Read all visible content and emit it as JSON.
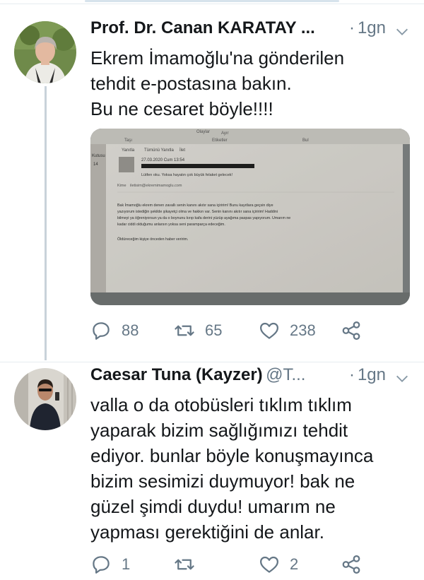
{
  "tweets": [
    {
      "author": {
        "display_name": "Prof. Dr. Canan KARATAY ...",
        "handle": "",
        "avatar_icon": "profile-photo-woman"
      },
      "separator": "·",
      "time": "1gn",
      "text_lines": [
        "Ekrem İmamoğlu'na gönderilen",
        "tehdit e-postasına bakın.",
        "Bu ne cesaret böyle!!!!"
      ],
      "media": {
        "type": "photo-of-email-screen",
        "toolbar": [
          "Yanıtla",
          "Tümünü Yanıtla",
          "İlet"
        ],
        "ribbon": [
          "Taşı",
          "Etiketler",
          "Bul",
          "Ayır",
          "Olaylar"
        ],
        "sidebar_labels": [
          "Kutusu",
          "14"
        ],
        "email_date": "27.03.2020 Cum 13:54",
        "email_subject": "Lütfen oku. Yoksa hayatın çok büyük felaket gelecek!",
        "email_to_label": "Kime",
        "email_to": "iletisim@ekremimamoglu.com",
        "body_lines": [
          "Bak İmamoğlu ekrem denen zavallı senin kanını akıtır sana içiririm! Bunu kayıtlara geçsin diye",
          "yazıyorum istediğin şekilde şikayetçi olma ve hakkın var. Senin kanını akıtır sana içiririm! Haddini",
          "bilmeyi ya öğreniyorsun ya da o boynunu kırıp kafa derini yüzüp ayağıma paspas yapıyorum. Umarım ne",
          "kadar ciddi olduğumu anlarsın yoksa seni paramparça edeceğim."
        ],
        "closing_line": "Öldüreceğim kişiye önceden haber veririm."
      },
      "actions": {
        "replies": "88",
        "retweets": "65",
        "likes": "238"
      }
    },
    {
      "author": {
        "display_name": "Caesar Tuna (Kayzer)",
        "handle": "@T...",
        "avatar_icon": "profile-photo-man"
      },
      "separator": "·",
      "time": "1gn",
      "text_lines": [
        "valla o da otobüsleri tıklım tıklım",
        "yaparak bizim sağlığımızı tehdit",
        "ediyor. bunlar böyle konuşmayınca",
        "bizim sesimizi duymuyor! bak ne",
        "güzel şimdi duydu! umarım ne",
        "yapması gerektiğini de anlar."
      ],
      "actions": {
        "replies": "1",
        "retweets": "",
        "likes": "2"
      }
    }
  ],
  "colors": {
    "text": "#14171a",
    "secondary": "#657786",
    "thread_line": "#c8d2da",
    "divider": "#e6ecf0"
  }
}
